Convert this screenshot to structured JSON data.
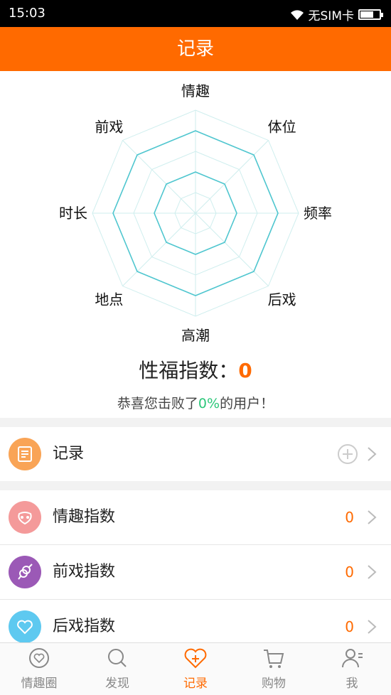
{
  "status_bar": {
    "time": "15:03",
    "carrier": "无SIM卡",
    "battery_level": 0.7
  },
  "title": "记录",
  "chart_data": {
    "type": "radar",
    "axes": [
      "情趣",
      "体位",
      "频率",
      "后戏",
      "高潮",
      "地点",
      "时长",
      "前戏"
    ],
    "rings": 5,
    "series": [
      {
        "values": [
          1,
          1,
          1,
          1,
          1,
          1,
          1,
          1
        ],
        "level_of_max": 0.4
      },
      {
        "values": [
          1,
          1,
          1,
          1,
          1,
          1,
          1,
          1
        ],
        "level_of_max": 0.8
      }
    ],
    "colors": {
      "grid": "#cfeeee",
      "series": "#4fc6cf"
    }
  },
  "score": {
    "label": "性福指数：",
    "value": "0"
  },
  "beat": {
    "prefix": "恭喜您击败了",
    "percent": "0%",
    "suffix": "的用户！"
  },
  "record_row": {
    "label": "记录",
    "icon": "notebook-icon",
    "color": "#f9a456"
  },
  "index_rows": [
    {
      "label": "情趣指数",
      "value": "0",
      "icon": "fun-icon",
      "color": "#f49a9a"
    },
    {
      "label": "前戏指数",
      "value": "0",
      "icon": "gender-icon",
      "color": "#9b59b6"
    },
    {
      "label": "后戏指数",
      "value": "0",
      "icon": "heart-icon",
      "color": "#5ec9f0"
    }
  ],
  "tabs": [
    {
      "label": "情趣圈",
      "icon": "heart-circle-icon",
      "active": false
    },
    {
      "label": "发现",
      "icon": "search-icon",
      "active": false
    },
    {
      "label": "记录",
      "icon": "heart-plus-icon",
      "active": true
    },
    {
      "label": "购物",
      "icon": "cart-icon",
      "active": false
    },
    {
      "label": "我",
      "icon": "user-icon",
      "active": false
    }
  ],
  "colors": {
    "accent": "#ff6a00",
    "success": "#2cc77a"
  }
}
